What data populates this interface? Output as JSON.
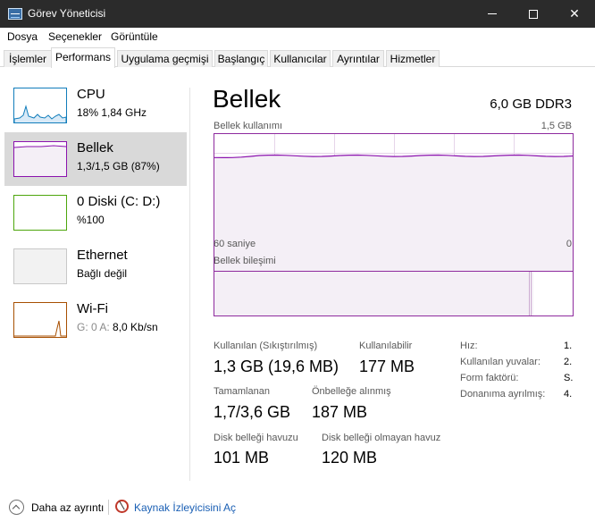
{
  "window": {
    "title": "Görev Yöneticisi"
  },
  "menu": [
    "Dosya",
    "Seçenekler",
    "Görüntüle"
  ],
  "tabs": [
    "İşlemler",
    "Performans",
    "Uygulama geçmişi",
    "Başlangıç",
    "Kullanıcılar",
    "Ayrıntılar",
    "Hizmetler"
  ],
  "active_tab": "Performans",
  "sidebar": {
    "items": [
      {
        "name": "CPU",
        "sub": "18%  1,84 GHz",
        "color": "#117dbb",
        "icon": "cpu-graph-icon"
      },
      {
        "name": "Bellek",
        "sub": "1,3/1,5 GB (87%)",
        "color": "#8b12ae",
        "icon": "memory-graph-icon",
        "selected": true
      },
      {
        "name": "0 Diski (C: D:)",
        "sub": "%100",
        "color": "#4da60c",
        "icon": "disk-graph-icon"
      },
      {
        "name": "Ethernet",
        "sub": "Bağlı değil",
        "color": "#a7a7a7",
        "icon": "ethernet-graph-icon"
      },
      {
        "name": "Wi-Fi",
        "sub_g": "G: 0 A: ",
        "sub_val": "8,0 Kb/sn",
        "color": "#a74f01",
        "icon": "wifi-graph-icon"
      }
    ]
  },
  "main": {
    "title": "Bellek",
    "spec": "6,0 GB DDR3",
    "usage_label": "Bellek kullanımı",
    "usage_max": "1,5 GB",
    "time_left": "60 saniye",
    "time_right": "0",
    "composition_label": "Bellek bileşimi",
    "usage_level": 0.87,
    "composition_in_use_fraction": 0.88,
    "stats": [
      {
        "label": "Kullanılan (Sıkıştırılmış)",
        "value": "1,3 GB (19,6 MB)"
      },
      {
        "label": "Kullanılabilir",
        "value": "177 MB"
      },
      {
        "label": "Tamamlanan",
        "value": "1,7/3,6 GB"
      },
      {
        "label": "Önbelleğe alınmış",
        "value": "187 MB"
      },
      {
        "label": "Disk belleği havuzu",
        "value": "101 MB"
      },
      {
        "label": "Disk belleği olmayan havuz",
        "value": "120 MB"
      }
    ],
    "info": [
      {
        "label": "Hız:",
        "value": "1."
      },
      {
        "label": "Kullanılan yuvalar:",
        "value": "2."
      },
      {
        "label": "Form faktörü:",
        "value": "S."
      },
      {
        "label": "Donanıma ayrılmış:",
        "value": "4."
      }
    ]
  },
  "bottom": {
    "less_details": "Daha az ayrıntı",
    "resource_monitor": "Kaynak İzleyicisini Aç"
  },
  "colors": {
    "memory": "#8b12ae",
    "titlebar": "#2b2b2b",
    "link": "#1a5fb4"
  }
}
